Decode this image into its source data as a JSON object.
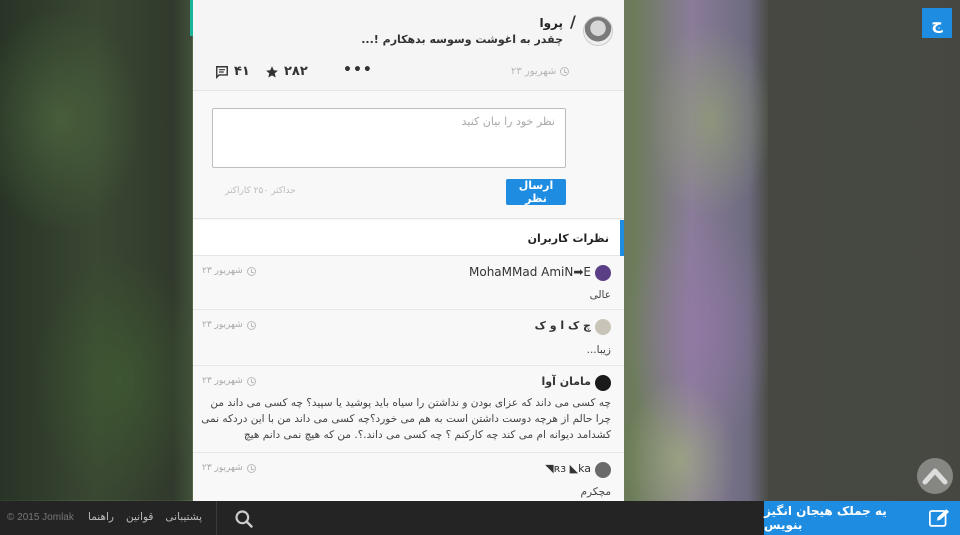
{
  "post": {
    "author": "پروا",
    "text": "چقدر به اغوشت وسوسه بدهکارم !...",
    "time": "۲۳ شهریور",
    "stars": "۲۸۲",
    "comments": "۴۱",
    "more": "•••"
  },
  "form": {
    "placeholder": "نظر خود را بیان کنید",
    "submit_label": "ارسال نظر",
    "char_limit": "حداکثر ۲۵۰ کاراکتر"
  },
  "comments_section": {
    "title": "نظرات کاربران",
    "items": [
      {
        "name": "MohaMMad AmiN➡E",
        "time": "۲۳ شهریور",
        "text": "عالی"
      },
      {
        "name": "چ ک ا و ک",
        "time": "۲۳ شهریور",
        "text": "زیبا..."
      },
      {
        "name": "مامان آوا",
        "time": "۲۳ شهریور",
        "text": "چه کسی می داند که عزای بودن و نداشتن را سیاه باید پوشید یا سپید؟ چه کسی می داند من چرا حالم از هرچه دوست داشتن است به هم می خورد؟چه کسی می داند من با این دردکه نمی کشدامد دیوانه ام می کند چه کارکنم ؟ چه کسی می داند.؟. من که هیچ نمی دانم هیچ"
      },
      {
        "name": "◥ʀɜ  ◣ka",
        "time": "۲۳ شهریور",
        "text": "مچکرم"
      }
    ]
  },
  "logo_letter": "ج",
  "footer": {
    "copyright": "© 2015 Jomlak",
    "links": [
      "پشتیبانی",
      "قوانین",
      "راهنما"
    ],
    "cta_label": "یه جملک هیجان انگیز بنویس"
  },
  "colors": {
    "accent": "#1e8ce0",
    "teal": "#19b49b",
    "footer": "#242424"
  }
}
